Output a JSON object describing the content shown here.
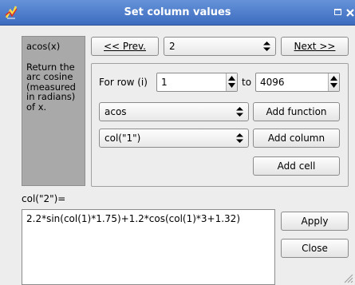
{
  "window": {
    "title": "Set column values"
  },
  "help": {
    "function": "acos(x)",
    "description": "Return the arc cosine (measured in radians) of x."
  },
  "nav": {
    "prev_label": "<< Prev.",
    "column_value": "2",
    "next_label": "Next >>"
  },
  "rows": {
    "label": "For row (i)",
    "from_value": "1",
    "to_label": "to",
    "to_value": "4096"
  },
  "function_select": {
    "value": "acos",
    "button_label": "Add function"
  },
  "column_select": {
    "value": "col(\"1\")",
    "button_label": "Add column"
  },
  "add_cell_label": "Add cell",
  "expression": {
    "label": "col(\"2\")=",
    "value": "2.2*sin(col(1)*1.75)+1.2*cos(col(1)*3+1.32)"
  },
  "actions": {
    "apply_label": "Apply",
    "close_label": "Close"
  },
  "colors": {
    "title_bar": "#4a78c8",
    "help_panel": "#a9a9a9",
    "window": "#ededed"
  }
}
